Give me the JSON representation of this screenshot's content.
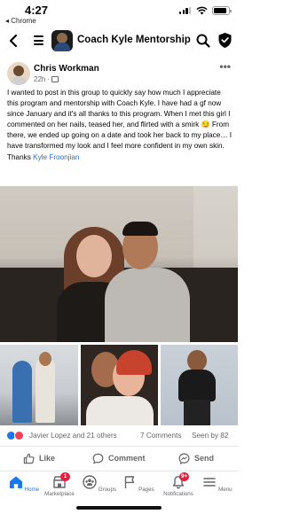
{
  "status_bar": {
    "time": "4:27",
    "back_app": "◂ Chrome"
  },
  "top_nav": {
    "group_name": "Coach Kyle Mentorship"
  },
  "post": {
    "author": "Chris Workman",
    "time": "22h",
    "more_label": "•••",
    "text": "I wanted to post in this group to quickly say how much I appreciate this program and mentorship with Coach Kyle. I have had a gf now since January and it's all thanks to this program. When I met this girl I commented on her nails, teased her, and flirted with a smirk 😏 From there, we ended up going on a date and took her back to my place… I have transformed my look and I feel more confident in my own skin. Thanks ",
    "tagged": "Kyle Froonjian",
    "reactions": {
      "likers": "Javier Lopez and 21 others",
      "comments": "7 Comments",
      "seen": "Seen by 82",
      "colors": {
        "like": "#1877f2",
        "love": "#f33e58"
      }
    },
    "actions": {
      "like": "Like",
      "comment": "Comment",
      "send": "Send"
    }
  },
  "tab_bar": {
    "items": [
      {
        "label": "Home",
        "icon": "home-icon",
        "active": true
      },
      {
        "label": "Marketplace",
        "icon": "marketplace-icon",
        "badge": "1"
      },
      {
        "label": "Groups",
        "icon": "groups-icon"
      },
      {
        "label": "Pages",
        "icon": "pages-icon"
      },
      {
        "label": "Notifications",
        "icon": "bell-icon",
        "badge": "9+"
      },
      {
        "label": "Menu",
        "icon": "menu-icon"
      }
    ],
    "accent": "#1877f2",
    "badge_color": "#e41e3f"
  }
}
